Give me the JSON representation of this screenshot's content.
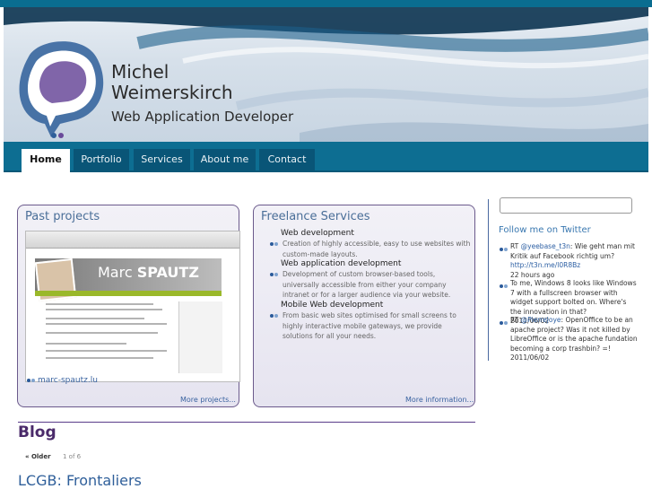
{
  "header": {
    "name_line1": "Michel",
    "name_line2": "Weimerskirch",
    "tagline": "Web Application Developer"
  },
  "nav": {
    "items": [
      {
        "label": "Home",
        "active": true
      },
      {
        "label": "Portfolio",
        "active": false
      },
      {
        "label": "Services",
        "active": false
      },
      {
        "label": "About me",
        "active": false
      },
      {
        "label": "Contact",
        "active": false
      }
    ]
  },
  "past_projects": {
    "title": "Past projects",
    "screenshot_brand_first": "Marc",
    "screenshot_brand_last": "SPAUTZ",
    "project_link": "marc-spautz.lu",
    "more_link": "More projects..."
  },
  "freelance": {
    "title": "Freelance Services",
    "services": [
      {
        "title": "Web development",
        "desc": "Creation of highly accessible, easy to use websites with custom-made layouts."
      },
      {
        "title": "Web application development",
        "desc": "Development of custom browser-based tools, universally accessible from either your company intranet or for a larger audience via your website."
      },
      {
        "title": "Mobile Web development",
        "desc": "From basic web sites optimised for small screens to highly interactive mobile gateways, we provide solutions for all your needs."
      }
    ],
    "more_link": "More information..."
  },
  "sidebar": {
    "search_placeholder": "",
    "follow_label": "Follow me on Twitter",
    "tweets": [
      {
        "prefix": "RT ",
        "mention": "@yeebase_t3n",
        "text": ": Wie geht man mit Kritik auf Facebook richtig um? ",
        "link": "http://t3n.me/l0R8Bz",
        "time": "22 hours ago"
      },
      {
        "prefix": "",
        "mention": "",
        "text": "To me, Windows 8 looks like Windows 7 with a fullscreen browser with widget support bolted on. Where's the innovation in that?",
        "link": "",
        "time": "2011/06/02"
      },
      {
        "prefix": "RT ",
        "mention": "@PierreJoye",
        "text": ": OpenOffice to be an apache project? Was it not killed by LibreOffice or is the apache fundation becoming a corp trashbin? =!",
        "link": "",
        "time": "2011/06/02"
      }
    ]
  },
  "blog": {
    "title": "Blog",
    "older_label": "« Older",
    "pager": "1 of 6",
    "post_title": "LCGB: Frontaliers"
  },
  "colors": {
    "nav_bar": "#0d6e92",
    "nav_tab": "#095577",
    "panel_border": "#6b5a8c",
    "link": "#3a63a0",
    "blog_title": "#4a2a6a"
  }
}
